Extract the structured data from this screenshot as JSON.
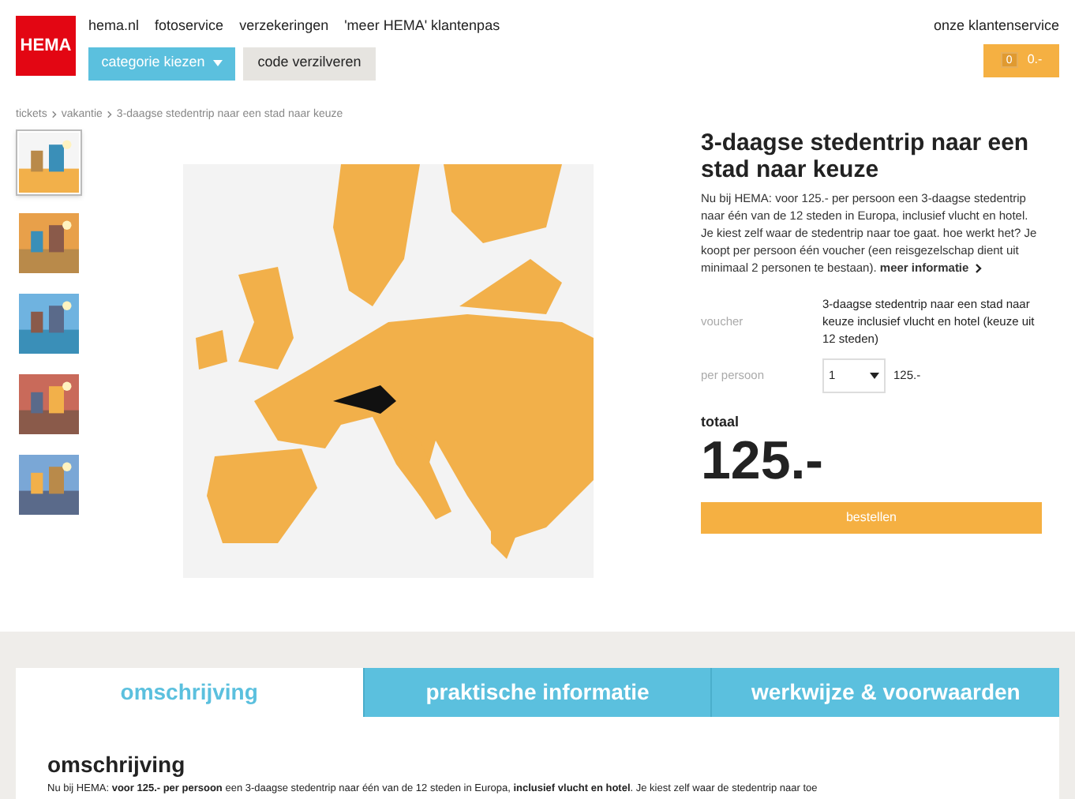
{
  "logo": "HEMA",
  "nav": [
    "hema.nl",
    "fotoservice",
    "verzekeringen",
    "'meer HEMA' klantenpas"
  ],
  "service_link": "onze klantenservice",
  "category_button": "categorie kiezen",
  "code_button": "code verzilveren",
  "cart": {
    "count": "0",
    "total": "0.-"
  },
  "breadcrumb": [
    "tickets",
    "vakantie",
    "3-daagse stedentrip naar een stad naar keuze"
  ],
  "thumbnails": [
    {
      "kind": "picture",
      "selected": true
    },
    {
      "kind": "picture",
      "selected": false
    },
    {
      "kind": "picture",
      "selected": false
    },
    {
      "kind": "picture",
      "selected": false
    },
    {
      "kind": "picture",
      "selected": false
    }
  ],
  "main_image": {
    "kind": "picture"
  },
  "product": {
    "title": "3-daagse stedentrip naar een stad naar keuze",
    "description": "Nu bij HEMA: voor 125.- per persoon een 3-daagse stedentrip naar één van de 12 steden in Europa, inclusief vlucht en hotel. Je kiest zelf waar de stedentrip naar toe gaat. hoe werkt het? Je koopt per persoon één voucher (een reisgezelschap dient uit minimaal 2 personen te bestaan).",
    "more_link": "meer informatie",
    "voucher_label": "voucher",
    "voucher_value": "3-daagse stedentrip naar een stad naar keuze inclusief vlucht en hotel (keuze uit 12 steden)",
    "per_person_label": "per persoon",
    "quantity": "1",
    "unit_price": "125.-",
    "total_label": "totaal",
    "total": "125.-",
    "order_button": "bestellen"
  },
  "tabs": [
    {
      "label": "omschrijving",
      "selected": true
    },
    {
      "label": "praktische informatie",
      "selected": false
    },
    {
      "label": "werkwijze & voorwaarden",
      "selected": false
    }
  ],
  "section": {
    "heading": "omschrijving",
    "text": "Nu bij HEMA: **voor 125.- per persoon** een 3-daagse stedentrip naar één van de 12 steden in Europa, **inclusief vlucht en hotel**. Je kiest zelf waar de stedentrip naar toe"
  }
}
